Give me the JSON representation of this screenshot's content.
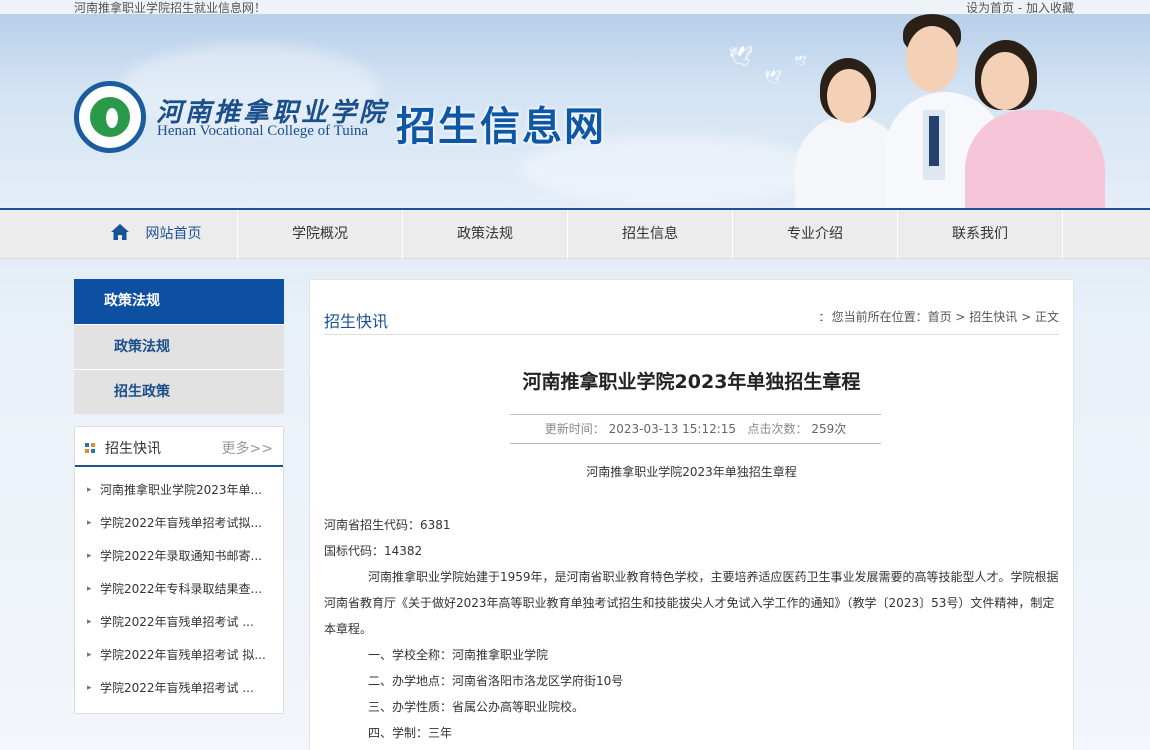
{
  "topbar": {
    "welcome": "河南推拿职业学院招生就业信息网！",
    "set_home": "设为首页",
    "separator": " - ",
    "add_fav": "加入收藏"
  },
  "header": {
    "school_cn": "河南推拿职业学院",
    "school_en": "Henan Vocational College of Tuina",
    "site_title": "招生信息网"
  },
  "nav": {
    "items": [
      {
        "label": "网站首页"
      },
      {
        "label": "学院概况"
      },
      {
        "label": "政策法规"
      },
      {
        "label": "招生信息"
      },
      {
        "label": "专业介绍"
      },
      {
        "label": "联系我们"
      }
    ]
  },
  "sidebar": {
    "title": "政策法规",
    "links": [
      {
        "label": "政策法规"
      },
      {
        "label": "招生政策"
      }
    ]
  },
  "news": {
    "title": "招生快讯",
    "more": "更多>>",
    "items": [
      "河南推拿职业学院2023年单...",
      "学院2022年盲残单招考试拟...",
      "学院2022年录取通知书邮寄...",
      "学院2022年专科录取结果查...",
      "学院2022年盲残单招考试 ...",
      "学院2022年盲残单招考试 拟...",
      "学院2022年盲残单招考试 ..."
    ]
  },
  "main": {
    "section": "招生快讯",
    "breadcrumb": {
      "prefix": "您当前所在位置：",
      "home": "首页",
      "sep": " > ",
      "category": "招生快讯",
      "current": "正文"
    },
    "title": "河南推拿职业学院2023年单独招生章程",
    "meta": {
      "update_label": "更新时间：",
      "update_value": "2023-03-13 15:12:15",
      "clicks_label": "点击次数：",
      "clicks_value": "259次"
    },
    "subtitle": "河南推拿职业学院2023年单独招生章程",
    "paragraphs": {
      "p1": "河南省招生代码：6381",
      "p2": "国标代码：14382",
      "p3": "河南推拿职业学院始建于1959年，是河南省职业教育特色学校，主要培养适应医药卫生事业发展需要的高等技能型人才。学院根据河南省教育厅《关于做好2023年高等职业教育单独考试招生和技能拔尖人才免试入学工作的通知》（教学〔2023〕53号）文件精神，制定本章程。",
      "p4": "一、学校全称：河南推拿职业学院",
      "p5": "二、办学地点：河南省洛阳市洛龙区学府街10号",
      "p6": "三、办学性质：省属公办高等职业院校。",
      "p7": "四、学制：三年"
    }
  }
}
